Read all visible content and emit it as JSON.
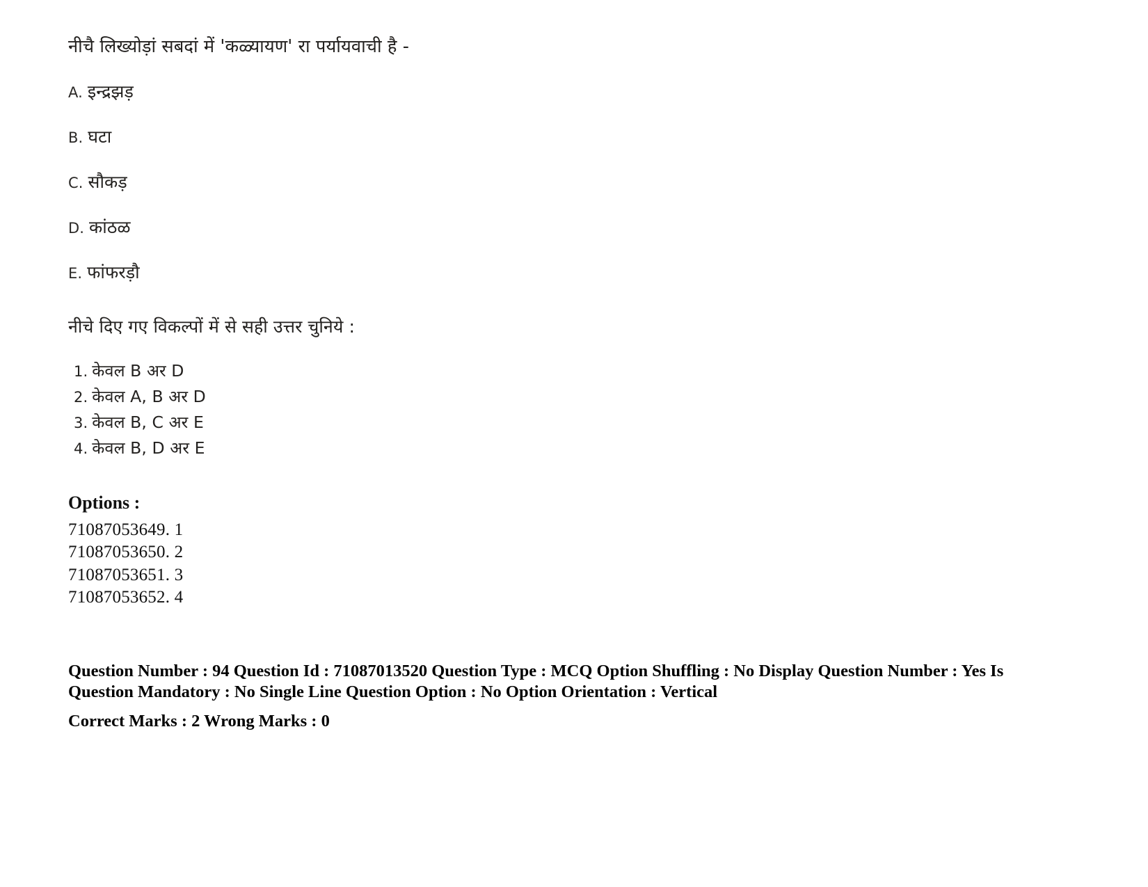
{
  "question": {
    "stem": "नीचै लिख्योड़ां सबदां में 'कळ्यायण' रा पर्यायवाची है -",
    "statements": [
      {
        "letter": "A.",
        "text": "इन्द्रझड़"
      },
      {
        "letter": "B.",
        "text": "घटा"
      },
      {
        "letter": "C.",
        "text": "सौकड़"
      },
      {
        "letter": "D.",
        "text": "कांठळ"
      },
      {
        "letter": "E.",
        "text": "फांफरड़ौ"
      }
    ],
    "choose_instruction": "नीचे दिए गए विकल्पों में से सही उत्तर चुनिये :",
    "choices": [
      {
        "num": "1.",
        "text": "केवल B अर D"
      },
      {
        "num": "2.",
        "text": "केवल A, B अर D"
      },
      {
        "num": "3.",
        "text": "केवल B, C अर E"
      },
      {
        "num": "4.",
        "text": "केवल B, D अर E"
      }
    ]
  },
  "options": {
    "heading": "Options :",
    "rows": [
      "71087053649. 1",
      "71087053650. 2",
      "71087053651. 3",
      "71087053652. 4"
    ]
  },
  "meta": {
    "line1": "Question Number : 94 Question Id : 71087013520 Question Type : MCQ Option Shuffling : No Display Question Number : Yes Is Question Mandatory : No Single Line Question Option : No Option Orientation : Vertical",
    "line2": "Correct Marks : 2 Wrong Marks : 0"
  }
}
